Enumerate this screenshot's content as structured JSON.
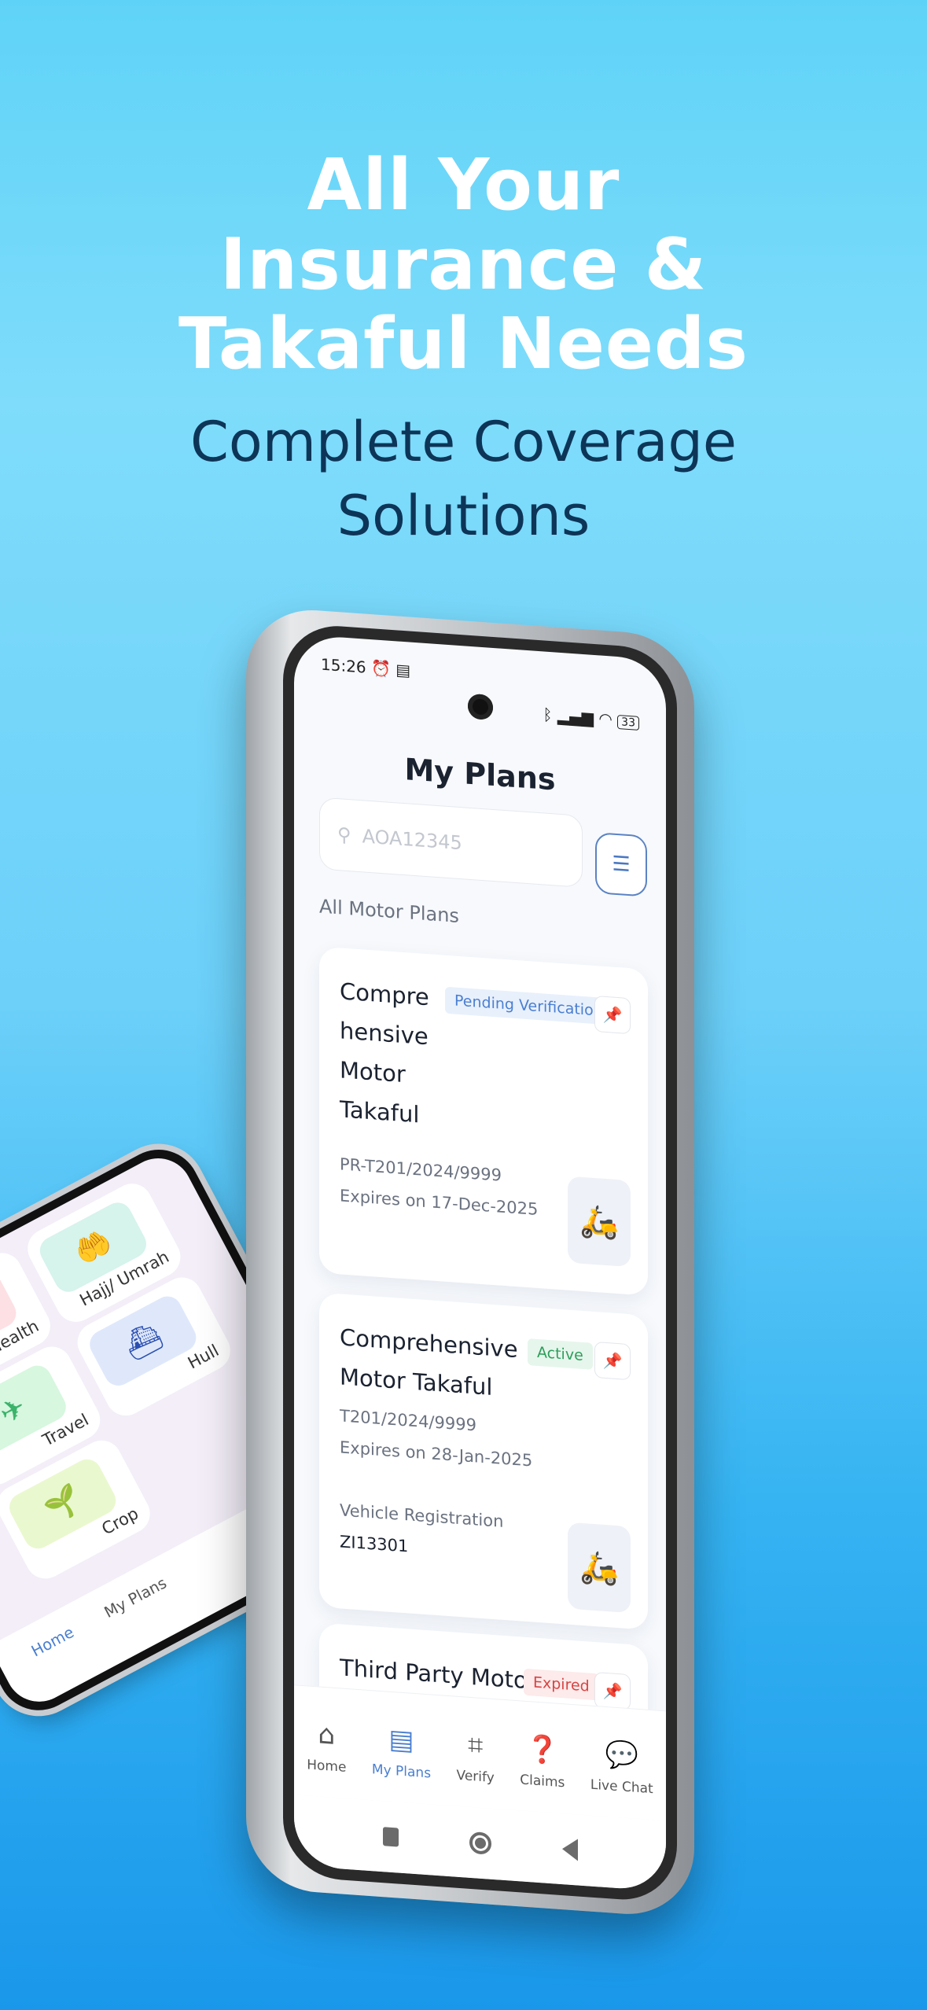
{
  "hero": {
    "headline_lines": [
      "All Your",
      "Insurance &",
      "Takaful Needs"
    ],
    "subhead_lines": [
      "Complete Coverage",
      "Solutions"
    ]
  },
  "colors": {
    "headline": "#ffffff",
    "subhead": "#0d3557",
    "accent": "#4a7fd0",
    "active": "#2e9e5b",
    "expired": "#d64545"
  },
  "back_phone": {
    "tiles": [
      {
        "label": "Health",
        "icon": "health-icon"
      },
      {
        "label": "Hajj/ Umrah",
        "icon": "hands-icon"
      },
      {
        "label": "Travel",
        "icon": "travel-icon"
      },
      {
        "label": "Hull",
        "icon": "ship-icon"
      },
      {
        "label": "Crop",
        "icon": "plant-icon"
      }
    ],
    "nav": [
      {
        "label": "Home",
        "active": true
      },
      {
        "label": "My Plans"
      }
    ]
  },
  "status": {
    "time": "15:26",
    "battery": "33"
  },
  "screen": {
    "title": "My Plans",
    "search": {
      "placeholder": "AOA12345",
      "value": ""
    },
    "section_label": "All Motor Plans",
    "plans": [
      {
        "title": "Compre\nhensive\nMotor\nTakaful",
        "status": "Pending Verification",
        "number": "PR-T201/2024/9999",
        "expiry": "Expires on 17-Dec-2025"
      },
      {
        "title": "Comprehensive\nMotor Takaful",
        "status": "Active",
        "number": "T201/2024/9999",
        "expiry": "Expires on 28-Jan-2025",
        "reg_label": "Vehicle Registration",
        "reg_value": "ZI13301"
      },
      {
        "title": "Third Party Motor",
        "status": "Expired"
      }
    ],
    "nav": [
      {
        "label": "Home",
        "icon": "home-icon"
      },
      {
        "label": "My Plans",
        "icon": "certificate-icon",
        "active": true
      },
      {
        "label": "Verify",
        "icon": "qr-icon"
      },
      {
        "label": "Claims",
        "icon": "claims-book-icon"
      },
      {
        "label": "Live Chat",
        "icon": "chat-icon"
      }
    ]
  }
}
